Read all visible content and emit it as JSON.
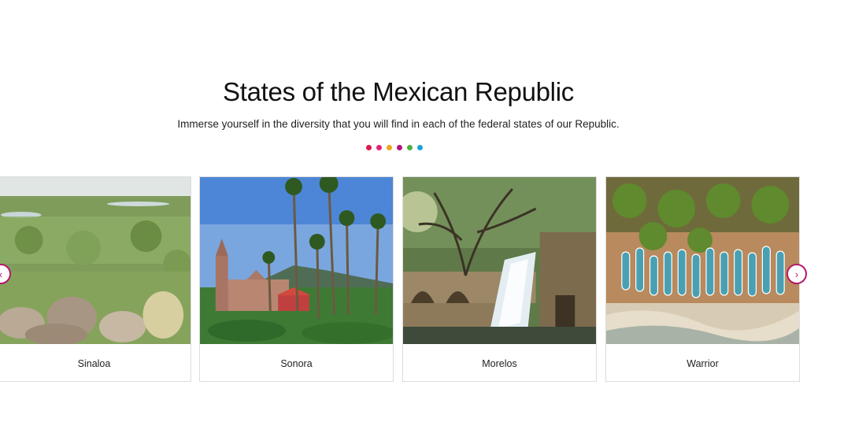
{
  "section": {
    "title": "States of the Mexican Republic",
    "subtitle": "Immerse yourself in the diversity that you will find in each of the federal states of our Republic."
  },
  "dots": [
    "#d81b4b",
    "#e0237a",
    "#f2a519",
    "#b3157a",
    "#4caf3c",
    "#1aa3d9"
  ],
  "carousel": {
    "prev_icon": "chevron-left-icon",
    "next_icon": "chevron-right-icon",
    "prev_glyph": "‹",
    "next_glyph": "›",
    "accent": "#b5176a",
    "cards": [
      {
        "label": "Sinaloa"
      },
      {
        "label": "Sonora"
      },
      {
        "label": "Morelos"
      },
      {
        "label": "Warrior"
      }
    ]
  }
}
